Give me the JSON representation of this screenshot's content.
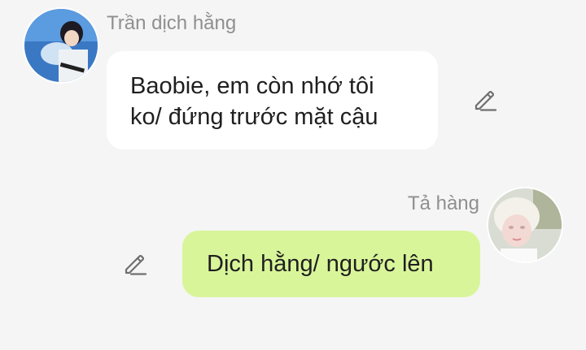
{
  "messages": [
    {
      "sender": "Trần dịch hằng",
      "side": "left",
      "avatar": "avatar-photo-boy",
      "lines": [
        "Baobie, em còn nhớ tôi",
        "ko/ đứng trước mặt cậu"
      ],
      "bubble_color": "#ffffff",
      "edit_icon": "pencil-icon"
    },
    {
      "sender": "Tả hàng",
      "side": "right",
      "avatar": "avatar-photo-blonde",
      "lines": [
        "Dịch hằng/ ngước lên"
      ],
      "bubble_color": "#d9f59a",
      "edit_icon": "pencil-icon"
    }
  ],
  "colors": {
    "background": "#f5f5f5",
    "sender_name": "#8f8f8f",
    "text": "#1f1f1f",
    "icon": "#6f6f6f"
  }
}
